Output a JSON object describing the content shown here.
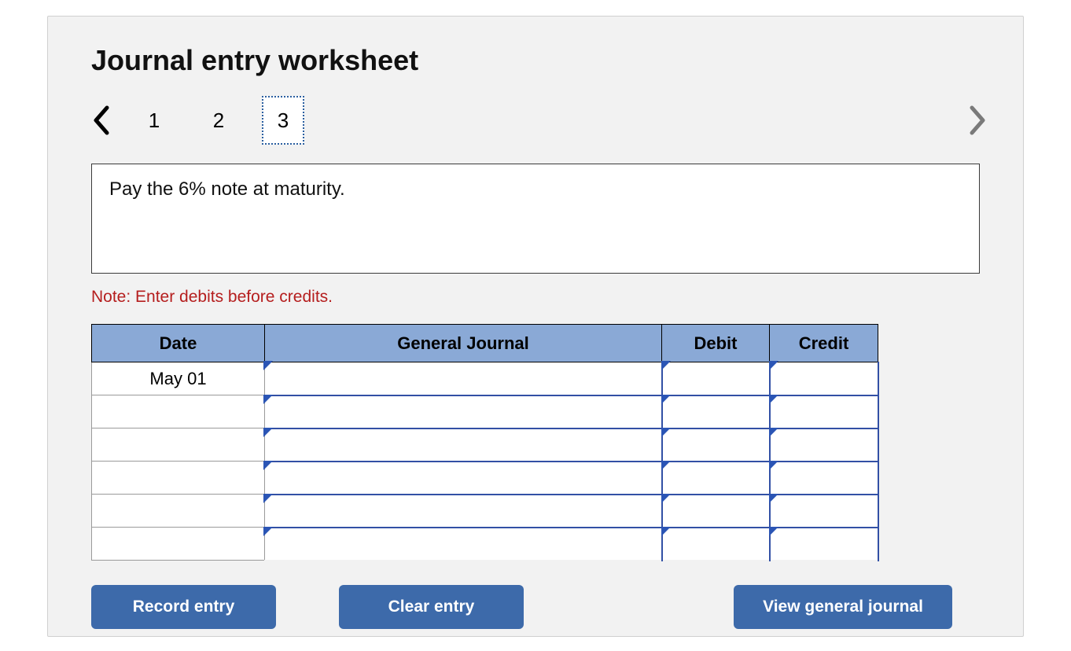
{
  "title": "Journal entry worksheet",
  "pager": {
    "pages": [
      "1",
      "2",
      "3"
    ],
    "selected_index": 2
  },
  "description": "Pay the 6% note at maturity.",
  "note": "Note: Enter debits before credits.",
  "table": {
    "headers": {
      "date": "Date",
      "gj": "General Journal",
      "debit": "Debit",
      "credit": "Credit"
    },
    "rows": [
      {
        "date": "May 01",
        "gj": "",
        "debit": "",
        "credit": ""
      },
      {
        "date": "",
        "gj": "",
        "debit": "",
        "credit": ""
      },
      {
        "date": "",
        "gj": "",
        "debit": "",
        "credit": ""
      },
      {
        "date": "",
        "gj": "",
        "debit": "",
        "credit": ""
      },
      {
        "date": "",
        "gj": "",
        "debit": "",
        "credit": ""
      },
      {
        "date": "",
        "gj": "",
        "debit": "",
        "credit": ""
      }
    ]
  },
  "buttons": {
    "record": "Record entry",
    "clear": "Clear entry",
    "view": "View general journal"
  }
}
